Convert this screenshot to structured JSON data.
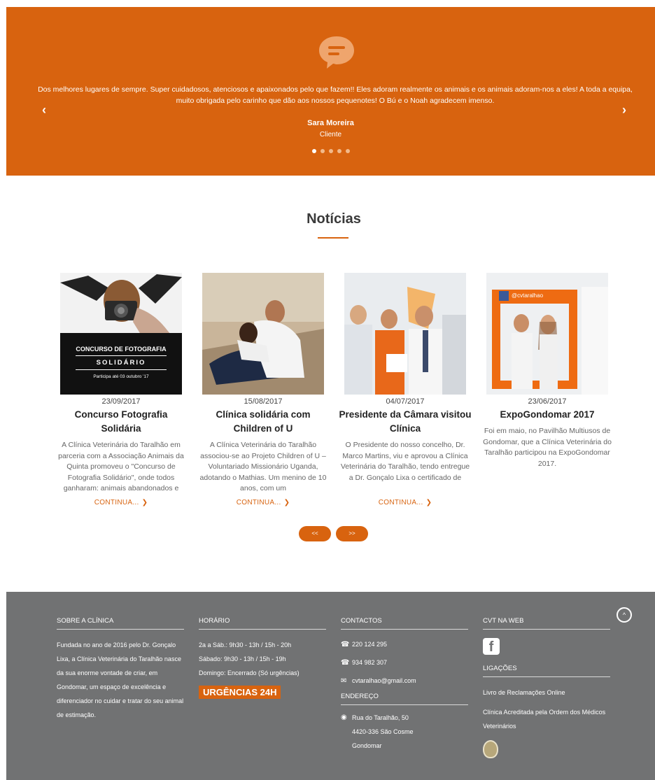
{
  "testimonial": {
    "quote": "Dos melhores lugares de sempre. Super cuidadosos, atenciosos e apaixonados pelo que fazem!! Eles adoram realmente os animais e os animais adoram-nos a eles! A toda a equipa, muito obrigada pelo carinho que dão aos nossos pequenotes! O Bú e o Noah agradecem imenso.",
    "name": "Sara Moreira",
    "role": "Cliente",
    "prev": "‹",
    "next": "›",
    "slides": 5,
    "active_slide": 1
  },
  "news": {
    "title": "Notícias",
    "read_more": "CONTINUA...",
    "items": [
      {
        "date": "23/09/2017",
        "title": "Concurso Fotografia Solidária",
        "excerpt": "A Clínica Veterinária do Taralhão em parceria com a Associação Animais da Quinta promoveu o \"Concurso de Fotografia Solidário\", onde todos ganharam: animais abandonados e",
        "image_caption_1": "CONCURSO DE FOTOGRAFIA",
        "image_caption_2": "SOLIDÁRIO",
        "image_caption_3": "Participa até 03 outubro '17",
        "has_more": true
      },
      {
        "date": "15/08/2017",
        "title": "Clínica solidária com Children of U",
        "excerpt": "A Clínica Veterinária do Taralhão associou-se ao Projeto Children of U – Voluntariado Missionário Uganda, adotando o Mathias. Um menino de 10 anos, com um",
        "has_more": true
      },
      {
        "date": "04/07/2017",
        "title": "Presidente da Câmara visitou Clínica",
        "excerpt": "O Presidente do nosso concelho, Dr. Marco Martins, viu e aprovou a Clínica Veterinária do Taralhão, tendo entregue a Dr. Gonçalo Lixa o certificado de",
        "has_more": true
      },
      {
        "date": "23/06/2017",
        "title": "ExpoGondomar 2017",
        "excerpt": "Foi em maio, no Pavilhão Multiusos de Gondomar, que a Clínica Veterinária do Taralhão participou na ExpoGondomar 2017.",
        "image_caption_1": "@cvtaralhao",
        "has_more": false
      }
    ],
    "pager_prev": "<<",
    "pager_next": ">>"
  },
  "footer": {
    "about": {
      "heading": "SOBRE A CLÍNICA",
      "text": "Fundada no ano de 2016 pelo Dr. Gonçalo Lixa, a Clínica Veterinária do Taralhão nasce da sua enorme vontade de criar, em Gondomar, um espaço de excelência e diferenciador no cuidar e tratar do seu animal de estimação."
    },
    "hours": {
      "heading": "HORÁRIO",
      "line1": "2a a Sáb.: 9h30 - 13h / 15h - 20h",
      "line2": "Sábado: 9h30 - 13h / 15h - 19h",
      "line3": "Domingo: Encerrado (Só urgências)",
      "urgent": "URGÊNCIAS 24H"
    },
    "contacts": {
      "heading": "CONTACTOS",
      "phone1": "220 124 295",
      "phone2": "934 982 307",
      "email": "cvtaralhao@gmail.com",
      "address_heading": "ENDEREÇO",
      "address1": "Rua do Taralhão, 50",
      "address2": "4420-336 São Cosme",
      "address3": "Gondomar"
    },
    "web": {
      "heading": "CVT NA WEB",
      "facebook": "f",
      "links_heading": "LIGAÇÕES",
      "link1": "Livro de Reclamações Online",
      "link2": "Clínica Acreditada pela Ordem dos Médicos Veterinários"
    },
    "to_top": "^"
  },
  "colors": {
    "accent": "#d8630f",
    "footer_bg": "#717273"
  }
}
